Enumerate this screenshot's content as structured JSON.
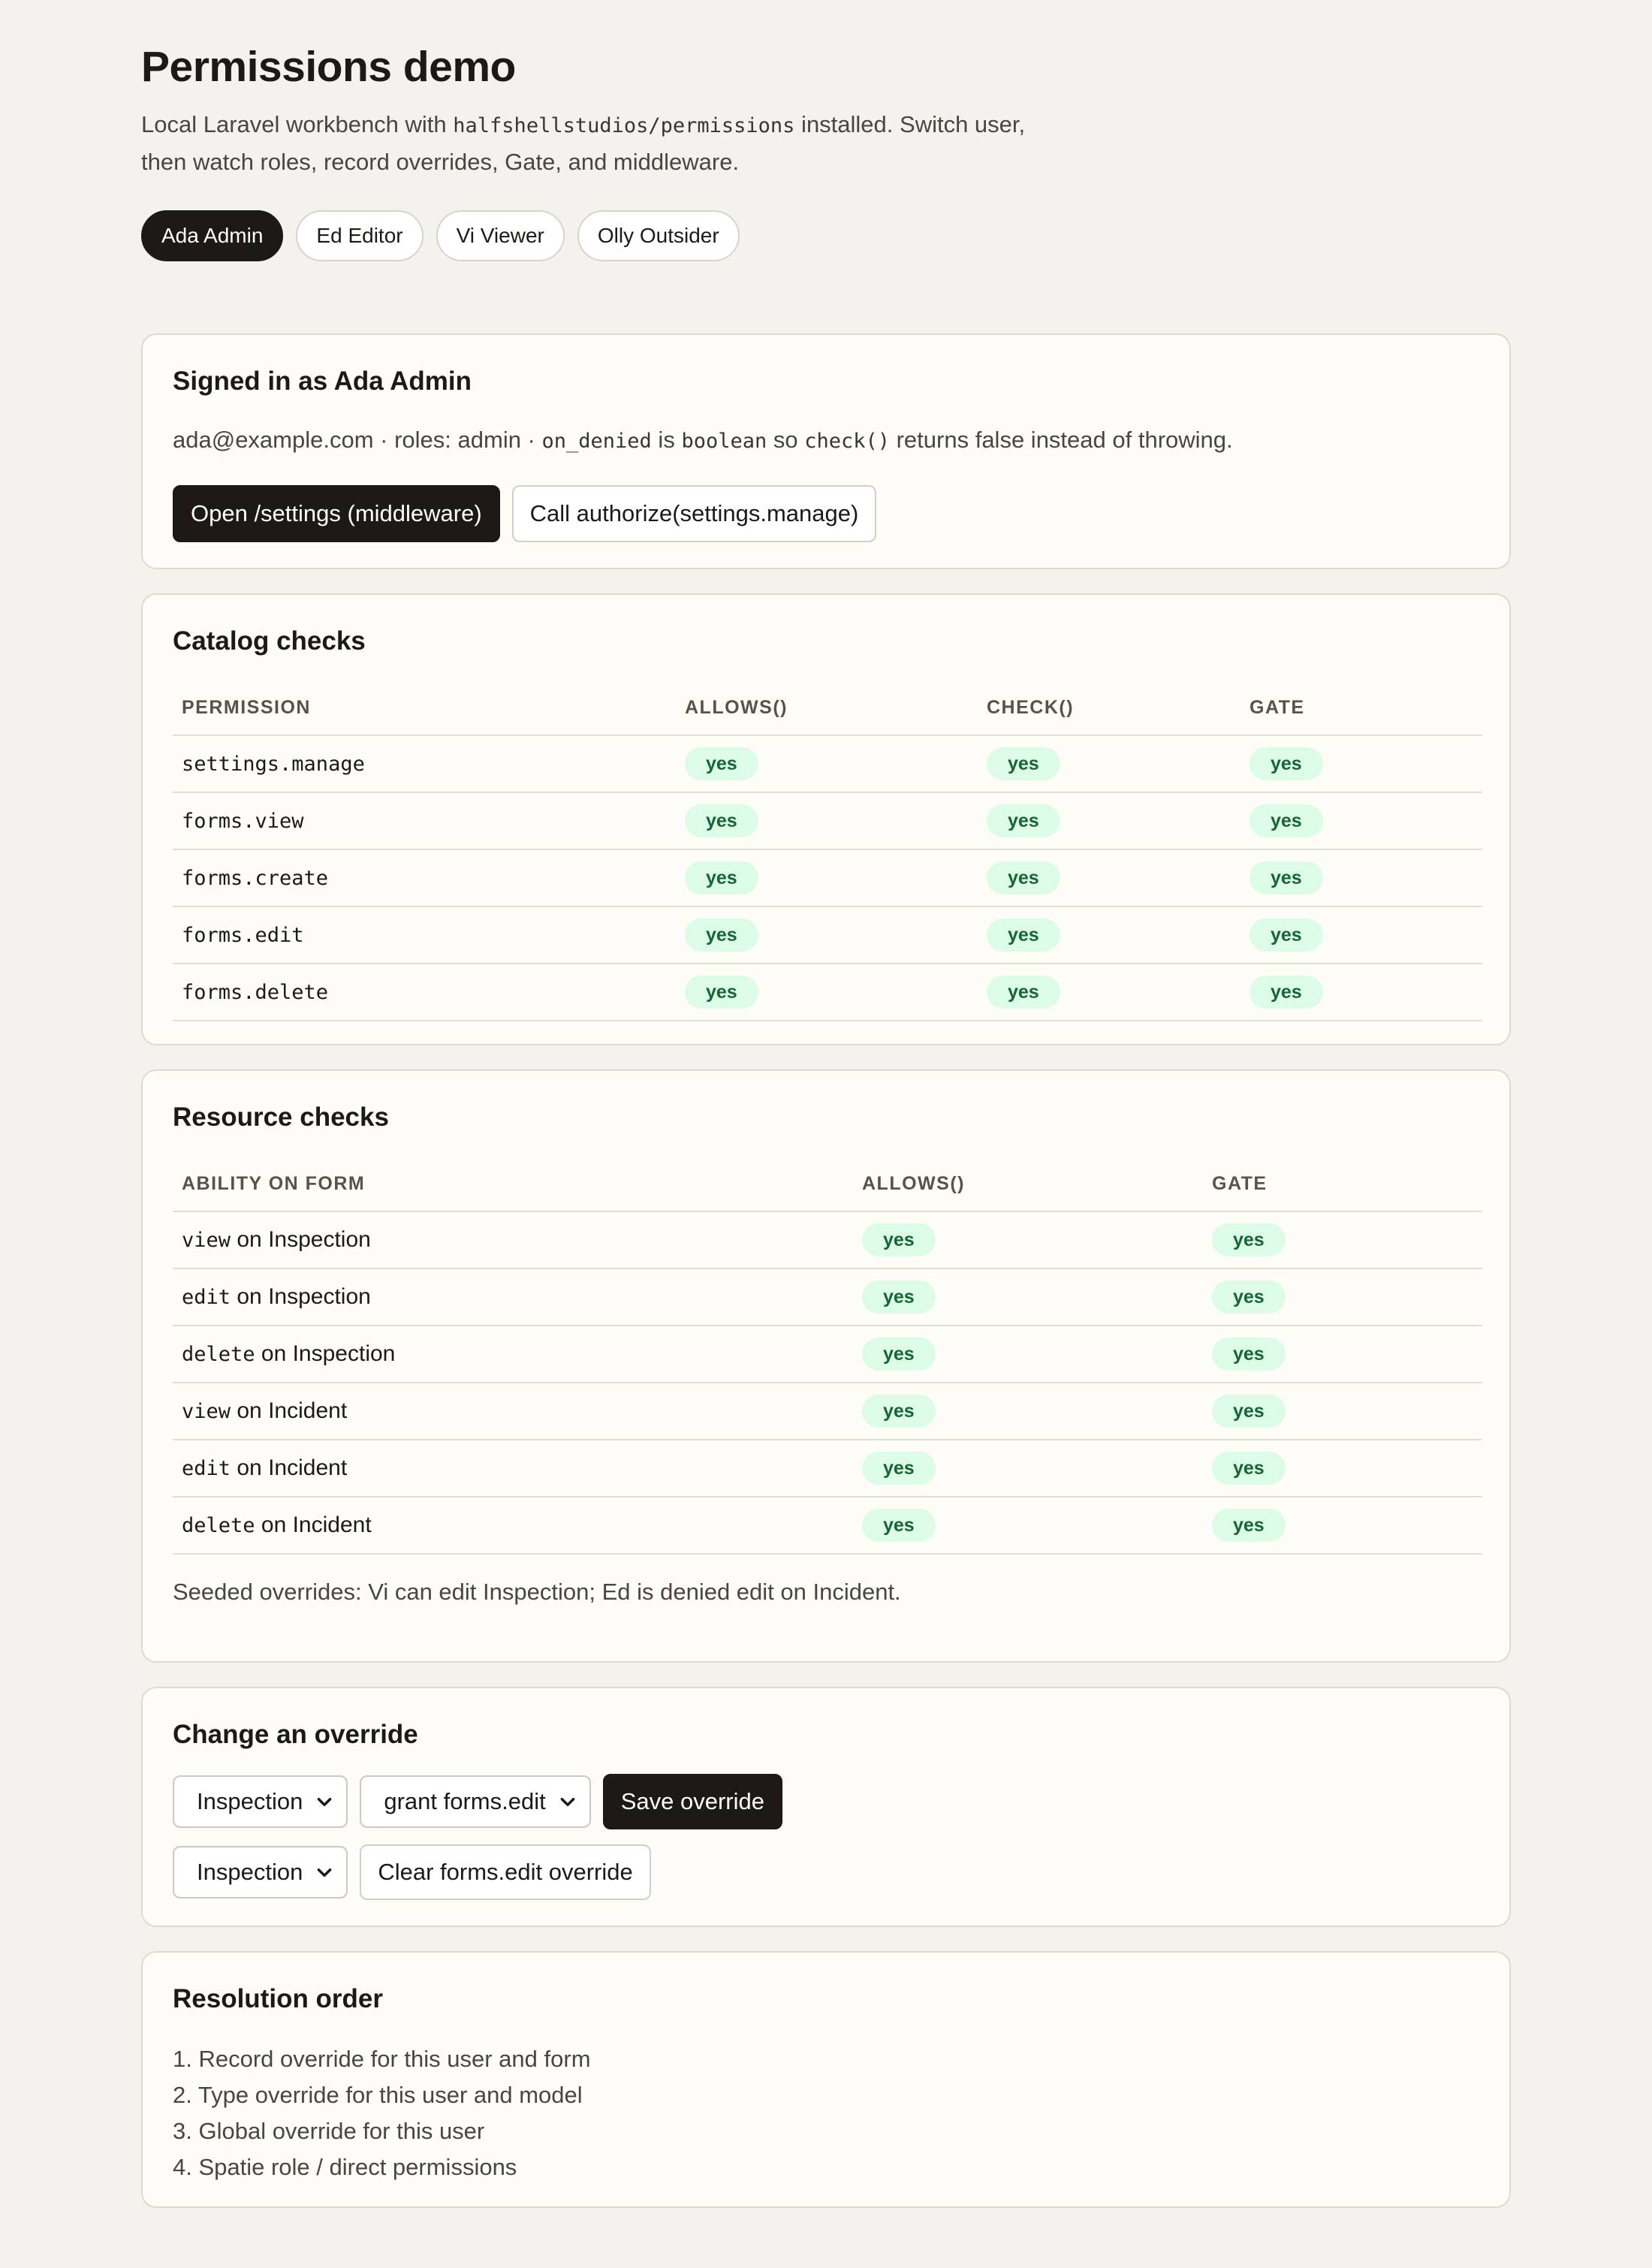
{
  "title": "Permissions demo",
  "intro": {
    "part1": "Local Laravel workbench with ",
    "package": "halfshellstudios/permissions",
    "part2": " installed. Switch user,",
    "line2": "then watch roles, record overrides, Gate, and middleware."
  },
  "users": [
    {
      "label": "Ada Admin",
      "active": true
    },
    {
      "label": "Ed Editor",
      "active": false
    },
    {
      "label": "Vi Viewer",
      "active": false
    },
    {
      "label": "Olly Outsider",
      "active": false
    }
  ],
  "signed": {
    "title": "Signed in as Ada Admin",
    "email_roles": "ada@example.com · roles: admin · ",
    "on_denied": "on_denied",
    "is": " is ",
    "boolean": "boolean",
    "so": " so ",
    "check": "check()",
    "tail": " returns false instead of throwing.",
    "btn_middleware": "Open /settings (middleware)",
    "btn_authorize": "Call authorize(settings.manage)"
  },
  "catalog": {
    "title": "Catalog checks",
    "headers": [
      "PERMISSION",
      "ALLOWS()",
      "CHECK()",
      "GATE"
    ],
    "rows": [
      {
        "permission": "settings.manage",
        "allows": "yes",
        "check": "yes",
        "gate": "yes"
      },
      {
        "permission": "forms.view",
        "allows": "yes",
        "check": "yes",
        "gate": "yes"
      },
      {
        "permission": "forms.create",
        "allows": "yes",
        "check": "yes",
        "gate": "yes"
      },
      {
        "permission": "forms.edit",
        "allows": "yes",
        "check": "yes",
        "gate": "yes"
      },
      {
        "permission": "forms.delete",
        "allows": "yes",
        "check": "yes",
        "gate": "yes"
      }
    ]
  },
  "resource": {
    "title": "Resource checks",
    "headers": [
      "ABILITY ON FORM",
      "ALLOWS()",
      "GATE"
    ],
    "on": " on ",
    "rows": [
      {
        "ability": "view",
        "form": "Inspection",
        "allows": "yes",
        "gate": "yes"
      },
      {
        "ability": "edit",
        "form": "Inspection",
        "allows": "yes",
        "gate": "yes"
      },
      {
        "ability": "delete",
        "form": "Inspection",
        "allows": "yes",
        "gate": "yes"
      },
      {
        "ability": "view",
        "form": "Incident",
        "allows": "yes",
        "gate": "yes"
      },
      {
        "ability": "edit",
        "form": "Incident",
        "allows": "yes",
        "gate": "yes"
      },
      {
        "ability": "delete",
        "form": "Incident",
        "allows": "yes",
        "gate": "yes"
      }
    ],
    "note": "Seeded overrides: Vi can edit Inspection; Ed is denied edit on Incident."
  },
  "override": {
    "title": "Change an override",
    "form_select": "Inspection",
    "action_select": "grant forms.edit",
    "save": "Save override",
    "form_select_2": "Inspection",
    "clear": "Clear forms.edit override"
  },
  "order": {
    "title": "Resolution order",
    "items": [
      "1. Record override for this user and form",
      "2. Type override for this user and model",
      "3. Global override for this user",
      "4. Spatie role / direct permissions"
    ]
  },
  "colors": {
    "background": "#f4f2ed",
    "card": "#fefcf7",
    "dark": "#1c1917",
    "badge_bg": "#dcfce7",
    "badge_text": "#166534"
  }
}
